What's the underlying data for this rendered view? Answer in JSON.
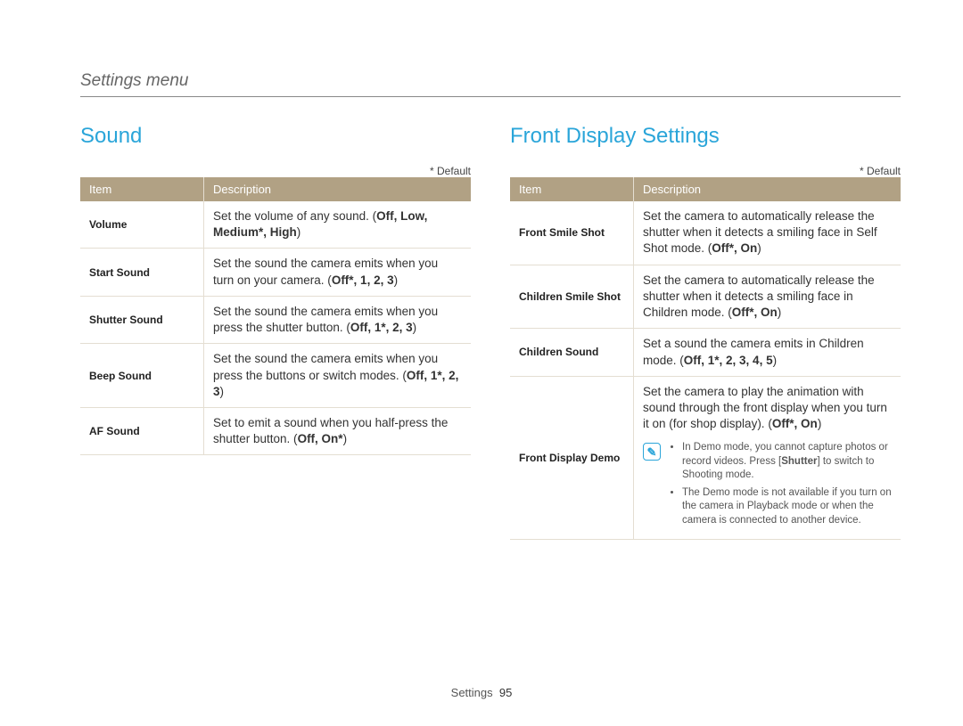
{
  "section_title": "Settings menu",
  "default_note": "* Default",
  "footer": {
    "label": "Settings",
    "page": "95"
  },
  "left": {
    "heading": "Sound",
    "headers": {
      "item": "Item",
      "desc": "Description"
    },
    "rows": [
      {
        "item": "Volume",
        "desc_pre": "Set the volume of any sound. (",
        "opts": "Off, Low, Medium*, High",
        "desc_post": ")"
      },
      {
        "item": "Start Sound",
        "desc_pre": "Set the sound the camera emits when you turn on your camera. (",
        "opts": "Off*, 1, 2, 3",
        "desc_post": ")"
      },
      {
        "item": "Shutter Sound",
        "desc_pre": "Set the sound the camera emits when you press the shutter button. (",
        "opts": "Off, 1*, 2, 3",
        "desc_post": ")"
      },
      {
        "item": "Beep Sound",
        "desc_pre": "Set the sound the camera emits when you press the buttons or switch modes. (",
        "opts": "Off, 1*, 2, 3",
        "desc_post": ")"
      },
      {
        "item": "AF Sound",
        "desc_pre": "Set to emit a sound when you half-press the shutter button. (",
        "opts": "Off, On*",
        "desc_post": ")"
      }
    ]
  },
  "right": {
    "heading": "Front Display Settings",
    "headers": {
      "item": "Item",
      "desc": "Description"
    },
    "rows": [
      {
        "item": "Front Smile Shot",
        "desc_pre": "Set the camera to automatically release the shutter when it detects a smiling face in Self Shot mode. (",
        "opts": "Off*, On",
        "desc_post": ")"
      },
      {
        "item": "Children Smile Shot",
        "desc_pre": "Set the camera to automatically release the shutter when it detects a smiling face in Children mode. (",
        "opts": "Off*, On",
        "desc_post": ")"
      },
      {
        "item": "Children Sound",
        "desc_pre": "Set a sound the camera emits in Children mode. (",
        "opts": "Off, 1*, 2, 3, 4, 5",
        "desc_post": ")"
      }
    ],
    "demo_row": {
      "item": "Front Display Demo",
      "desc_pre": "Set the camera to play the animation with sound through the front display when you turn it on (for shop display). (",
      "opts": "Off*, On",
      "desc_post": ")",
      "note_icon": "✎",
      "notes": {
        "n1_a": "In Demo mode, you cannot capture photos or record videos. Press [",
        "n1_b": "Shutter",
        "n1_c": "] to switch to Shooting mode.",
        "n2": "The Demo mode is not available if you turn on the camera in Playback mode or when the camera is connected to another device."
      }
    }
  }
}
